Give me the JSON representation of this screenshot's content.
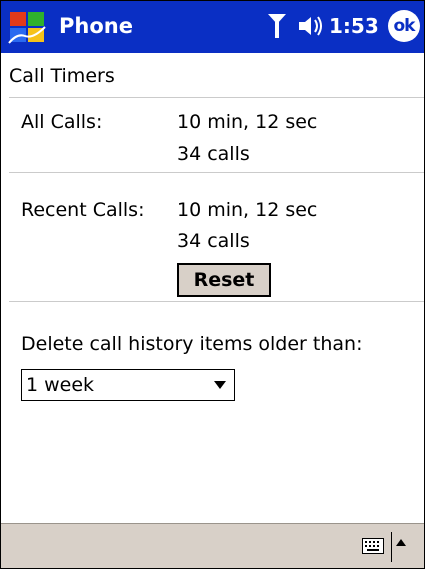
{
  "titlebar": {
    "app_title": "Phone",
    "time": "1:53",
    "ok_label": "ok",
    "icons": [
      "windows-start-icon",
      "signal-antenna-icon",
      "speaker-volume-icon"
    ]
  },
  "header": {
    "title": "Call Timers"
  },
  "all_calls": {
    "label": "All Calls:",
    "duration": "10 min, 12 sec",
    "count": "34 calls"
  },
  "recent_calls": {
    "label": "Recent Calls:",
    "duration": "10 min, 12 sec",
    "count": "34 calls",
    "reset_label": "Reset"
  },
  "history": {
    "label": "Delete call history items older than:",
    "selected": "1 week"
  },
  "colors": {
    "titlebar": "#0a2fc4",
    "button_bg": "#d8d0c8"
  },
  "bottombar": {
    "icons": [
      "keyboard-icon",
      "up-arrow-icon"
    ]
  }
}
